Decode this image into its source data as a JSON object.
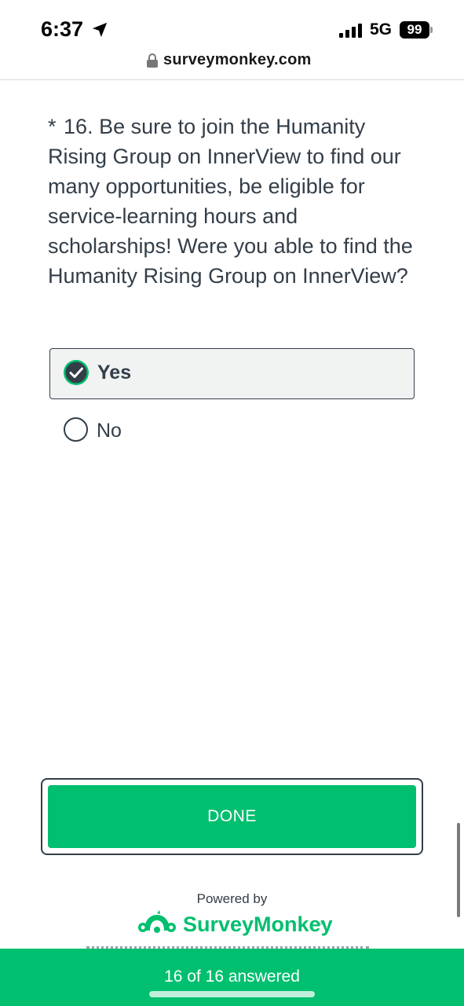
{
  "status_bar": {
    "time": "6:37",
    "network": "5G",
    "battery": "99",
    "icons": [
      "location-arrow-icon",
      "signal-bars-icon",
      "battery-icon"
    ]
  },
  "browser": {
    "url": "surveymonkey.com",
    "icon": "lock-icon"
  },
  "question": {
    "required_marker": "*",
    "text": "16. Be sure to join the Humanity Rising Group on InnerView to find our many opportunities, be eligible for service-learning hours and scholarships! Were you able to find the Humanity Rising Group on InnerView?"
  },
  "options": {
    "yes": {
      "label": "Yes",
      "selected": true
    },
    "no": {
      "label": "No",
      "selected": false
    }
  },
  "done_button": {
    "label": "DONE"
  },
  "footer": {
    "powered_by": "Powered by",
    "brand": "SurveyMonkey",
    "brand_trademark": "®"
  },
  "progress": {
    "text": "16 of 16 answered",
    "answered": 16,
    "total": 16
  },
  "colors": {
    "accent": "#00bf6f",
    "text": "#333e48",
    "selected_bg": "#f1f2f2"
  }
}
